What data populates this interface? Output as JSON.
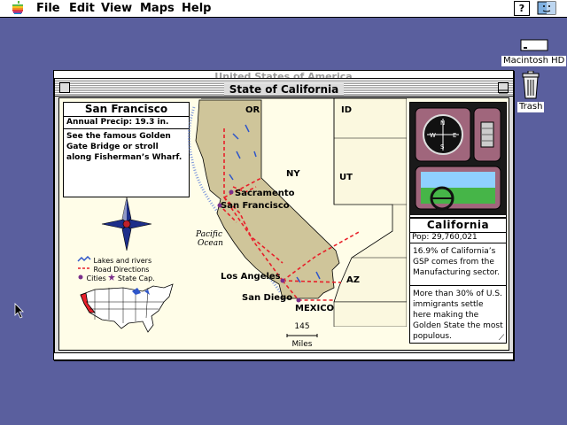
{
  "menubar": {
    "items": [
      "File",
      "Edit",
      "View",
      "Maps",
      "Help"
    ],
    "help_glyph": "?"
  },
  "desktop": {
    "hd_label": "Macintosh HD",
    "trash_label": "Trash"
  },
  "back_window": {
    "title": "United States of America"
  },
  "window": {
    "title": "State of California"
  },
  "city": {
    "name": "San Francisco",
    "precip": "Annual Precip: 19.3 in.",
    "description": "See the famous Golden Gate Bridge or stroll along Fisherman’s Wharf."
  },
  "legend": {
    "lakes": "Lakes and rivers",
    "roads": "Road Directions",
    "cities": "Cities",
    "capital": "State Cap."
  },
  "map": {
    "neighbors": [
      "OR",
      "ID",
      "NY",
      "UT",
      "AZ",
      "MEXICO"
    ],
    "ocean": [
      "Pacific",
      "Ocean"
    ],
    "cities": [
      "Sacramento",
      "San Francisco",
      "Los Angeles",
      "San Diego"
    ],
    "scale_value": "145",
    "scale_unit": "Miles"
  },
  "state": {
    "name": "California",
    "population": "Pop: 29,760,021",
    "gsp": "16.9% of California’s GSP comes from the Manufacturing sector.",
    "immigration": "More than 30% of U.S. immigrants settle here making the Golden State the most populous."
  },
  "compass": [
    "N",
    "W",
    "E",
    "S"
  ],
  "colors": {
    "desktop": "#5a5f9e",
    "land": "#cfc59a",
    "road": "#e8202a",
    "water": "#2f56c9",
    "city_dot": "#7a2f8a"
  }
}
